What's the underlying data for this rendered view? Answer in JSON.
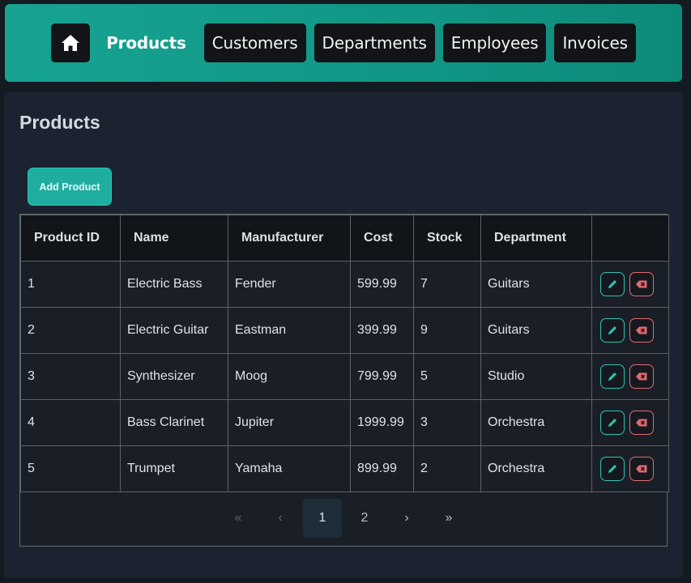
{
  "nav": {
    "home_icon": "home-icon",
    "items": [
      {
        "label": "Products",
        "active": true
      },
      {
        "label": "Customers"
      },
      {
        "label": "Departments"
      },
      {
        "label": "Employees"
      },
      {
        "label": "Invoices"
      }
    ]
  },
  "page": {
    "title": "Products",
    "add_label": "Add Product"
  },
  "table": {
    "columns": [
      "Product ID",
      "Name",
      "Manufacturer",
      "Cost",
      "Stock",
      "Department"
    ],
    "rows": [
      [
        "1",
        "Electric Bass",
        "Fender",
        "599.99",
        "7",
        "Guitars"
      ],
      [
        "2",
        "Electric Guitar",
        "Eastman",
        "399.99",
        "9",
        "Guitars"
      ],
      [
        "3",
        "Synthesizer",
        "Moog",
        "799.99",
        "5",
        "Studio"
      ],
      [
        "4",
        "Bass Clarinet",
        "Jupiter",
        "1999.99",
        "3",
        "Orchestra"
      ],
      [
        "5",
        "Trumpet",
        "Yamaha",
        "899.99",
        "2",
        "Orchestra"
      ]
    ],
    "row_action_icons": [
      "pencil-icon",
      "delete-icon"
    ]
  },
  "pagination": {
    "first": "«",
    "prev": "‹",
    "pages": [
      "1",
      "2"
    ],
    "current": "1",
    "next": "›",
    "last": "»"
  },
  "colors": {
    "nav_bg": "#119685",
    "accent": "#1fada0",
    "edit": "#2fc3b2",
    "delete": "#e06b6f",
    "panel_bg": "#1c2330"
  }
}
